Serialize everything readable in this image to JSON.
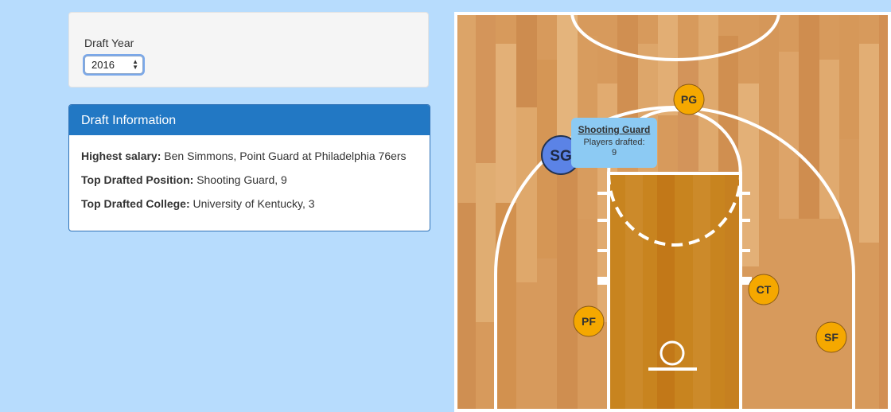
{
  "filter": {
    "label": "Draft Year",
    "selected_year": "2016"
  },
  "info": {
    "title": "Draft Information",
    "rows": [
      {
        "label": "Highest salary:",
        "value": "Ben Simmons, Point Guard at Philadelphia 76ers"
      },
      {
        "label": "Top Drafted Position:",
        "value": "Shooting Guard, 9"
      },
      {
        "label": "Top Drafted College:",
        "value": "University of Kentucky, 3"
      }
    ]
  },
  "court": {
    "positions": [
      {
        "id": "PG",
        "label": "PG",
        "color": "#f5a800"
      },
      {
        "id": "SG",
        "label": "SG",
        "color": "#5b83e6"
      },
      {
        "id": "PF",
        "label": "PF",
        "color": "#f5a800"
      },
      {
        "id": "CT",
        "label": "CT",
        "color": "#f5a800"
      },
      {
        "id": "SF",
        "label": "SF",
        "color": "#f5a800"
      }
    ]
  },
  "tooltip": {
    "title": "Shooting Guard",
    "line1": "Players drafted:",
    "line2": "9"
  },
  "colors": {
    "background": "#b7dcfd",
    "header_blue": "#2278c4",
    "court_wood": "#d9985a",
    "marker_orange": "#f5a800",
    "marker_selected": "#5b83e6",
    "tooltip_bg": "#8ccaf3"
  }
}
